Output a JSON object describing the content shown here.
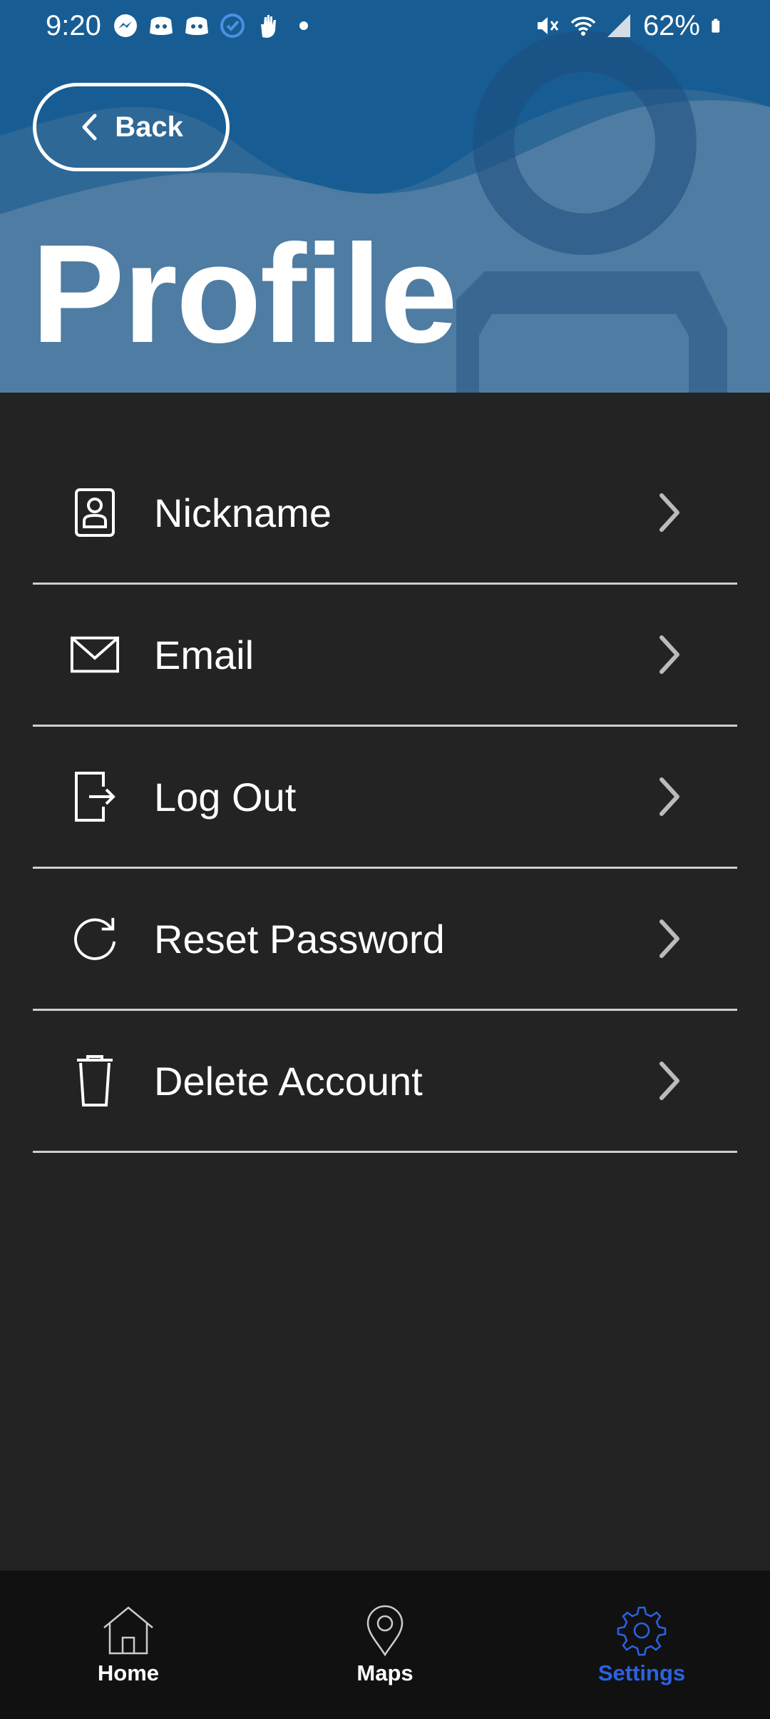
{
  "status_bar": {
    "time": "9:20",
    "battery": "62%",
    "left_icons": [
      "messenger-icon",
      "discord-icon",
      "discord-icon",
      "check-circle-icon",
      "hand-icon",
      "dot-icon"
    ],
    "right_icons": [
      "mute-icon",
      "wifi-icon",
      "signal-icon",
      "battery-icon"
    ]
  },
  "header": {
    "back_label": "Back",
    "title": "Profile",
    "background_color": "#175d93"
  },
  "menu": {
    "items": [
      {
        "label": "Nickname",
        "icon": "contact-card-icon"
      },
      {
        "label": "Email",
        "icon": "envelope-icon"
      },
      {
        "label": "Log Out",
        "icon": "logout-icon"
      },
      {
        "label": "Reset Password",
        "icon": "refresh-icon"
      },
      {
        "label": "Delete Account",
        "icon": "trash-icon"
      }
    ]
  },
  "bottom_nav": {
    "items": [
      {
        "label": "Home",
        "icon": "home-icon",
        "active": false
      },
      {
        "label": "Maps",
        "icon": "map-pin-icon",
        "active": false
      },
      {
        "label": "Settings",
        "icon": "gear-icon",
        "active": true
      }
    ],
    "active_color": "#2b62e3"
  }
}
